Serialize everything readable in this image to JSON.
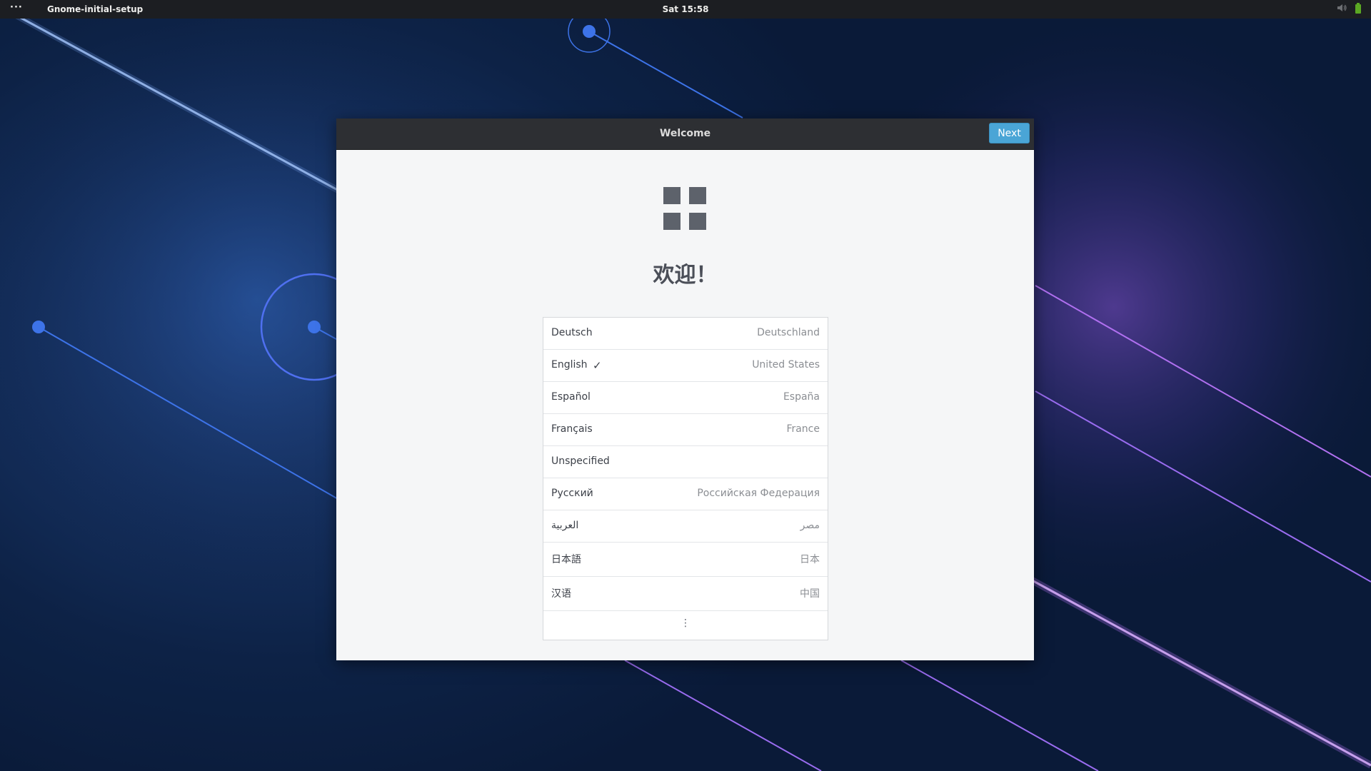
{
  "topbar": {
    "activities_label": "···",
    "app_name": "Gnome-initial-setup",
    "clock": "Sat 15:58",
    "icons": [
      "speaker-icon",
      "battery-icon"
    ]
  },
  "window": {
    "title": "Welcome",
    "next_label": "Next",
    "logo_icon": "distribution-logo-icon",
    "heading": "欢迎！",
    "languages": [
      {
        "name": "Deutsch",
        "region": "Deutschland",
        "selected": false
      },
      {
        "name": "English",
        "region": "United States",
        "selected": true
      },
      {
        "name": "Español",
        "region": "España",
        "selected": false
      },
      {
        "name": "Français",
        "region": "France",
        "selected": false
      },
      {
        "name": "Unspecified",
        "region": "",
        "selected": false
      },
      {
        "name": "Русский",
        "region": "Российская Федерация",
        "selected": false
      },
      {
        "name": "العربية",
        "region": "مصر",
        "selected": false
      },
      {
        "name": "日本語",
        "region": "日本",
        "selected": false
      },
      {
        "name": "汉语",
        "region": "中国",
        "selected": false
      }
    ],
    "more_icon": "view-more-icon",
    "check_glyph": "✓",
    "more_glyph": "⋮"
  },
  "colors": {
    "accent": "#4aa5d6",
    "headerbar": "#2d2f33",
    "topbar": "#1c1e22",
    "window_bg": "#f5f6f7",
    "wallpaper_lines_blue": "#3d73e8",
    "wallpaper_lines_purple": "#b070f0"
  }
}
